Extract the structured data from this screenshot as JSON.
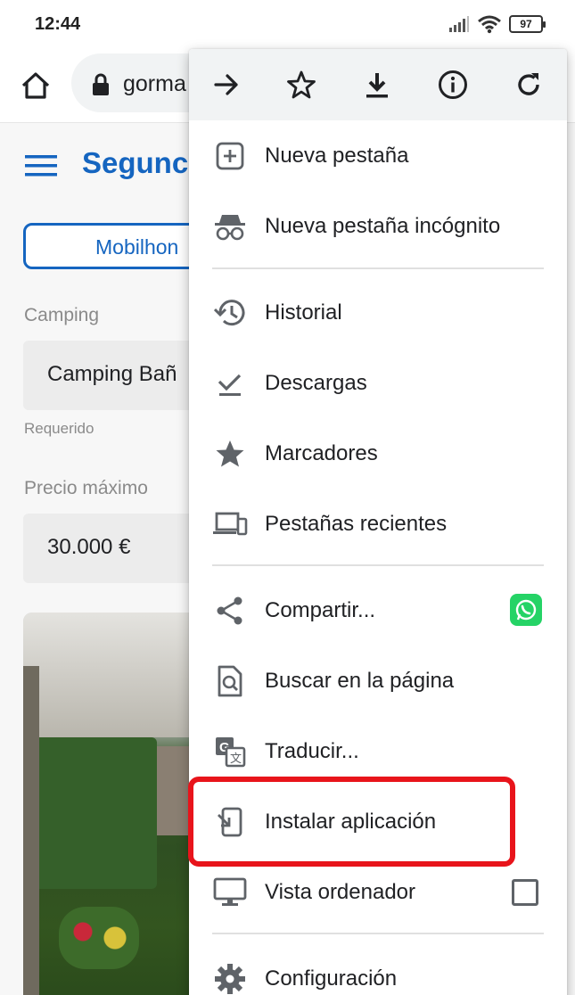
{
  "status_bar": {
    "time": "12:44",
    "battery": "97"
  },
  "browser": {
    "url": "gorma"
  },
  "page": {
    "site_title": "Segunc",
    "tab_label": "Mobilhon",
    "camping_label": "Camping",
    "camping_value": "Camping Bañ",
    "required_hint": "Requerido",
    "price_label": "Precio máximo",
    "price_value": "30.000 €"
  },
  "menu": {
    "top_actions": [
      "forward-icon",
      "star-icon",
      "download-icon",
      "info-icon",
      "reload-icon"
    ],
    "items": [
      {
        "label": "Nueva pestaña",
        "icon": "new-tab-icon"
      },
      {
        "label": "Nueva pestaña incógnito",
        "icon": "incognito-icon"
      },
      {
        "label": "Historial",
        "icon": "history-icon"
      },
      {
        "label": "Descargas",
        "icon": "downloads-icon"
      },
      {
        "label": "Marcadores",
        "icon": "bookmarks-icon"
      },
      {
        "label": "Pestañas recientes",
        "icon": "recent-tabs-icon"
      },
      {
        "label": "Compartir...",
        "icon": "share-icon"
      },
      {
        "label": "Buscar en la página",
        "icon": "find-in-page-icon"
      },
      {
        "label": "Traducir...",
        "icon": "translate-icon"
      },
      {
        "label": "Instalar aplicación",
        "icon": "install-app-icon"
      },
      {
        "label": "Vista ordenador",
        "icon": "desktop-icon"
      },
      {
        "label": "Configuración",
        "icon": "settings-icon"
      }
    ],
    "desktop_view_checked": false
  },
  "colors": {
    "accent": "#1565c0",
    "highlight": "#e8141b",
    "whatsapp": "#25d366"
  }
}
